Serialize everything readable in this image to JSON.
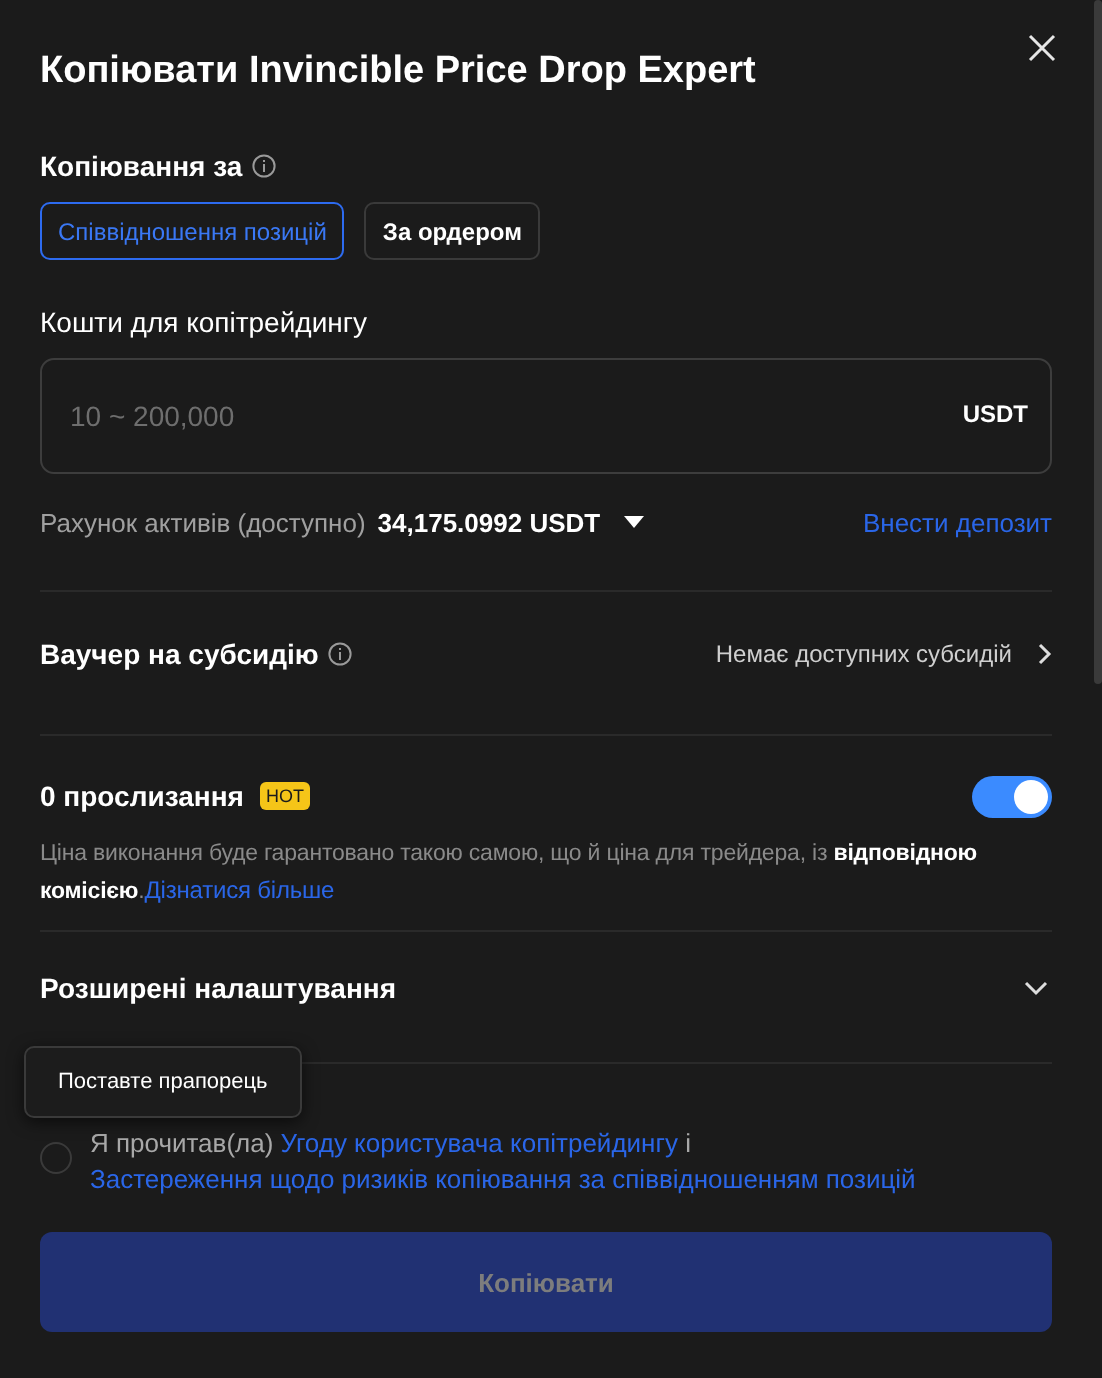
{
  "dialog": {
    "title": "Копіювати Invincible Price Drop Expert"
  },
  "copy_mode": {
    "label": "Копіювання за",
    "options": [
      {
        "label": "Співвідношення позицій",
        "selected": true
      },
      {
        "label": "За ордером",
        "selected": false
      }
    ]
  },
  "amount": {
    "label": "Кошти для копітрейдингу",
    "placeholder": "10 ~ 200,000",
    "unit": "USDT"
  },
  "account": {
    "label": "Рахунок активів (доступно)",
    "value": "34,175.0992 USDT",
    "link": "Внести депозит"
  },
  "voucher": {
    "label": "Ваучер на субсидію",
    "value": "Немає доступних субсидій"
  },
  "zero_slippage": {
    "label": "0 прослизання",
    "badge": "HOT",
    "on": true,
    "description": "Ціна виконання буде гарантовано такою самою, що й ціна для трейдера, із **відповідною комісією**.",
    "link": "Дізнатися більше"
  },
  "advanced": {
    "label": "Розширені налаштування",
    "expanded": false
  },
  "agreement": {
    "checked": false,
    "prefix": "Я прочитав(ла)",
    "link_1": "Угоду користувача копітрейдингу",
    "joiner": "і",
    "link_2": "Застереження щодо ризиків копіювання за співвідношенням позицій",
    "tooltip": "Поставте прапорець"
  },
  "submit": {
    "label": "Копіювати",
    "disabled": true
  }
}
